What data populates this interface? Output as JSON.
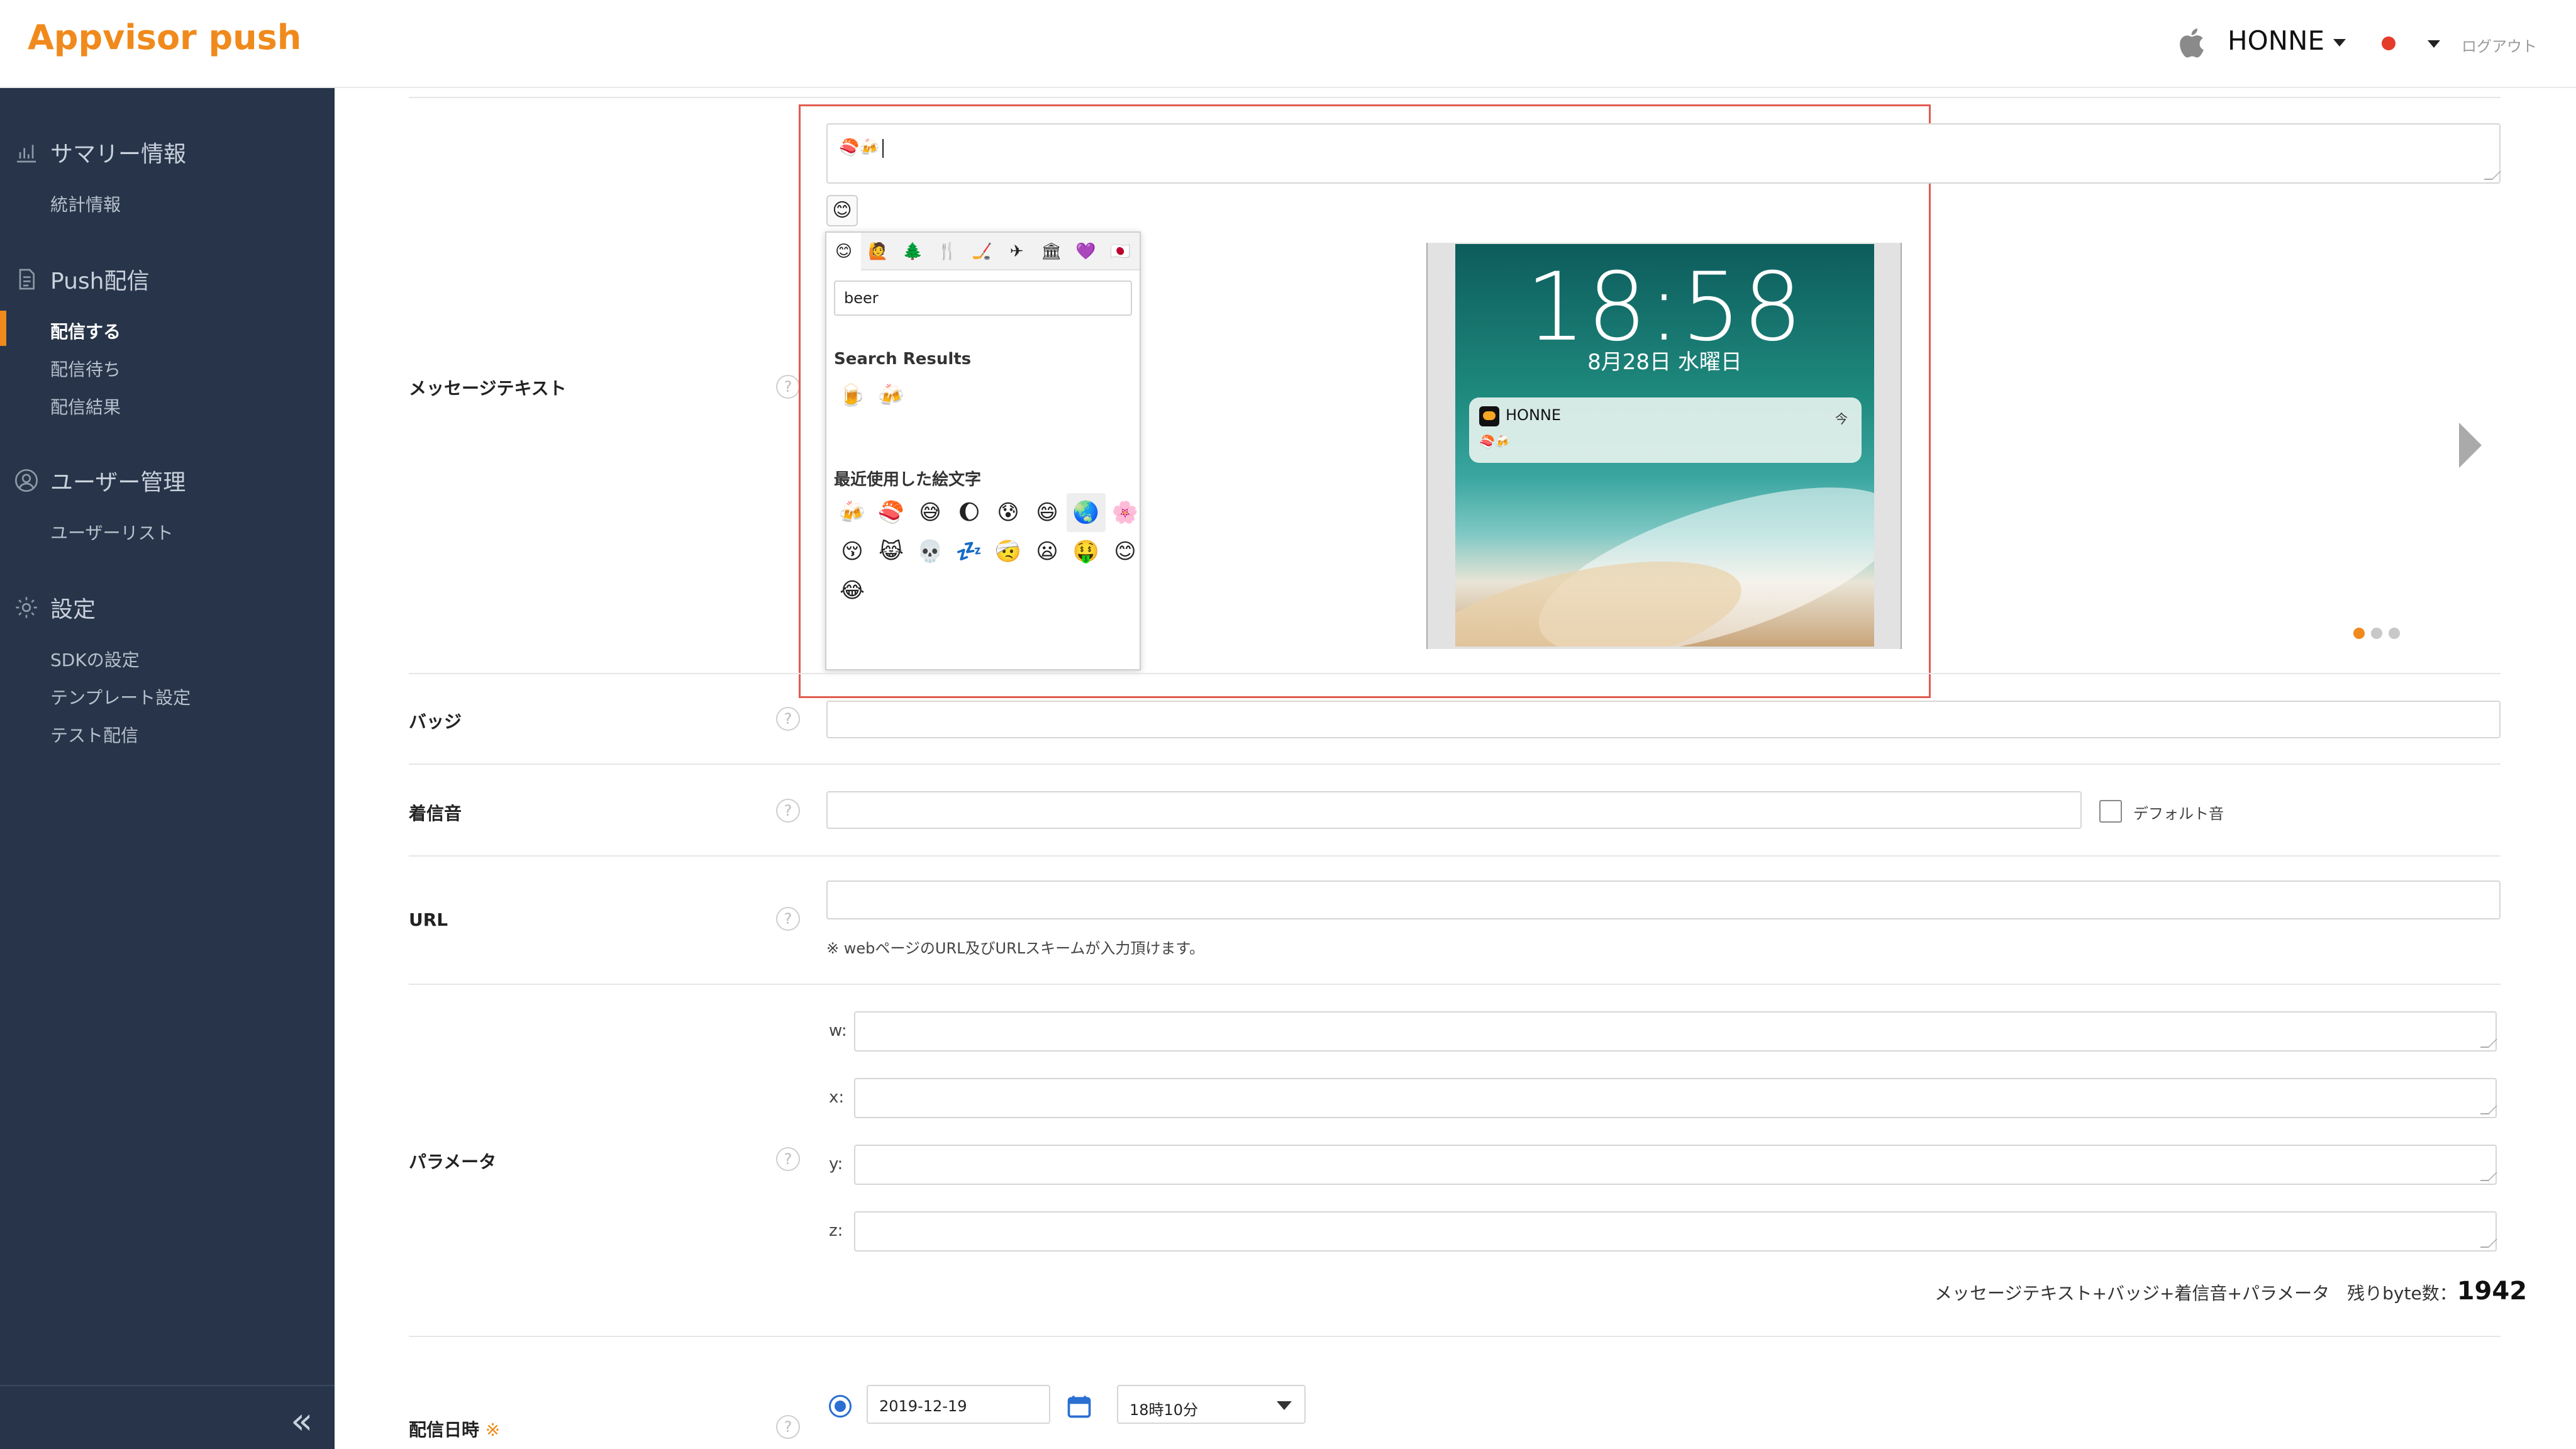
{
  "app": {
    "logo": "Appvisor push"
  },
  "header": {
    "account": "HONNE",
    "logout": "ログアウト"
  },
  "sidebar": {
    "sections": [
      {
        "label": "サマリー情報",
        "icon": "bar-chart-icon",
        "items": [
          "統計情報"
        ]
      },
      {
        "label": "Push配信",
        "icon": "document-icon",
        "items": [
          "配信する",
          "配信待ち",
          "配信結果"
        ]
      },
      {
        "label": "ユーザー管理",
        "icon": "user-icon",
        "items": [
          "ユーザーリスト"
        ]
      },
      {
        "label": "設定",
        "icon": "gear-icon",
        "items": [
          "SDKの設定",
          "テンプレート設定",
          "テスト配信"
        ]
      }
    ],
    "active_item": "配信する",
    "collapse": "«"
  },
  "form": {
    "message_label": "メッセージテキスト",
    "message_value": "🍣🍻",
    "badge_label": "バッジ",
    "sound_label": "着信音",
    "default_sound": "デフォルト音",
    "url_label": "URL",
    "url_note": "※ webページのURL及びURLスキームが入力頂けます。",
    "params_label": "パラメータ",
    "param_keys": [
      "w:",
      "x:",
      "y:",
      "z:"
    ],
    "bytes_text": "メッセージテキスト+バッジ+着信音+パラメータ　残りbyte数：",
    "bytes_value": "1942",
    "schedule_label": "配信日時",
    "schedule_required": "※",
    "date_value": "2019-12-19",
    "time_value": "18時10分",
    "help": "?"
  },
  "emoji_picker": {
    "button": "😊",
    "tabs": [
      "😊",
      "🙋",
      "🌲",
      "🍴",
      "🏒",
      "✈",
      "🏛",
      "💜",
      "🇯🇵"
    ],
    "search_value": "beer",
    "search_results_title": "Search Results",
    "search_results": [
      "🍺",
      "🍻"
    ],
    "recent_title": "最近使用した絵文字",
    "recent": [
      "🍻",
      "🍣",
      "😅",
      "🌔",
      "😰",
      "😄",
      "🌏",
      "🌸",
      "😚",
      "😹",
      "💀",
      "💤",
      "🤕",
      "😦",
      "🤑",
      "😊",
      "😂"
    ]
  },
  "preview": {
    "time": "18:58",
    "date": "8月28日 水曜日",
    "app_name": "HONNE",
    "now": "今",
    "message": "🍣🍻"
  }
}
